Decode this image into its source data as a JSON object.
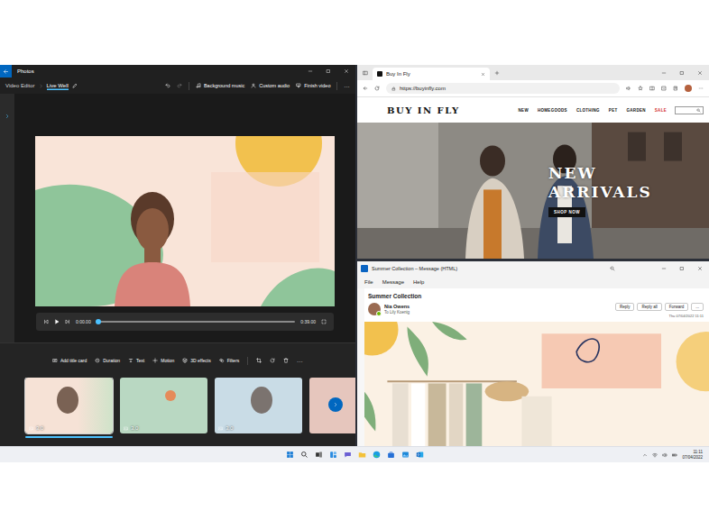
{
  "photos": {
    "title": "Photos",
    "breadcrumb": [
      {
        "label": "Video Editor",
        "selected": false
      },
      {
        "label": "Live Well",
        "selected": true
      }
    ],
    "actions": [
      {
        "label": "Background music"
      },
      {
        "label": "Custom audio"
      },
      {
        "label": "Finish video"
      }
    ],
    "more": "...",
    "player": {
      "current": "0:00.00",
      "total": "0:39.00",
      "level": 0.01
    },
    "tools": [
      {
        "label": "Add title card"
      },
      {
        "label": "Duration"
      },
      {
        "label": "Text"
      },
      {
        "label": "Motion"
      },
      {
        "label": "3D effects"
      },
      {
        "label": "Filters"
      }
    ],
    "clips": [
      {
        "duration": "3.0",
        "selected": true
      },
      {
        "duration": "3.0",
        "selected": false
      },
      {
        "duration": "3.0",
        "selected": false
      }
    ]
  },
  "browser": {
    "tab": {
      "label": "Buy In Fly",
      "selected": true
    },
    "url": "https://buyinfly.com",
    "site": {
      "logo": "BUY IN FLY",
      "nav": [
        {
          "label": "NEW",
          "highlighted": false
        },
        {
          "label": "HOMEGOODS",
          "highlighted": false
        },
        {
          "label": "CLOTHING",
          "highlighted": false
        },
        {
          "label": "PET",
          "highlighted": false
        },
        {
          "label": "GARDEN",
          "highlighted": false
        },
        {
          "label": "SALE",
          "highlighted": true
        }
      ],
      "hero": {
        "title": "NEW ARRIVALS",
        "button": "SHOP NOW"
      }
    }
  },
  "mail": {
    "title": "Summer Collection – Message (HTML)",
    "menu": [
      "File",
      "Message",
      "Help"
    ],
    "subject": "Summer Collection",
    "sender": "Nia Owens",
    "to": "To Lily Koenig",
    "actions": [
      "Reply",
      "Reply all",
      "Forward"
    ],
    "more": "...",
    "date": "Thu 07/04/2022 11:11"
  },
  "taskbar": {
    "time": "11:11",
    "date": "07/04/2022"
  }
}
